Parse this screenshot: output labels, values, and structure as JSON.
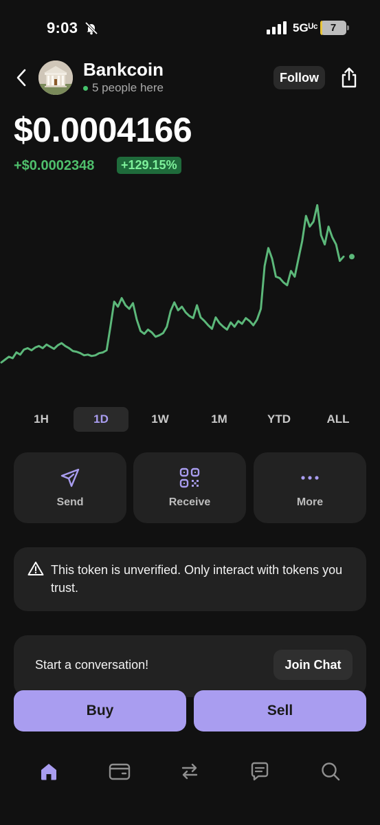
{
  "status_bar": {
    "time": "9:03",
    "network": "5Gᵁᶜ",
    "battery_level": "7",
    "battery_fraction": 0.07,
    "icons": [
      "bell-slash-icon",
      "signal-icon",
      "battery-icon"
    ]
  },
  "header": {
    "token_name": "Bankcoin",
    "presence": "5 people here",
    "follow_label": "Follow",
    "icons": [
      "back-icon",
      "share-icon"
    ]
  },
  "price": {
    "value": "$0.0004166",
    "change_abs": "+$0.0002348",
    "change_pct": "+129.15%"
  },
  "colors": {
    "accent": "#a99df0",
    "positive": "#4fbf6c",
    "chart_line": "#5cb87a",
    "background": "#111111",
    "card": "#222222"
  },
  "chart_data": {
    "type": "line",
    "title": "",
    "xlabel": "",
    "ylabel": "",
    "grid": false,
    "series": [
      {
        "values": [
          20,
          24,
          28,
          26,
          34,
          31,
          38,
          40,
          37,
          41,
          43,
          40,
          45,
          42,
          39,
          44,
          47,
          43,
          40,
          36,
          35,
          33,
          30,
          31,
          29,
          30,
          33,
          34,
          37,
          70,
          105,
          98,
          110,
          100,
          95,
          103,
          80,
          64,
          60,
          66,
          62,
          56,
          58,
          61,
          70,
          92,
          104,
          93,
          98,
          90,
          85,
          82,
          100,
          83,
          78,
          72,
          67,
          83,
          75,
          70,
          66,
          76,
          70,
          78,
          74,
          82,
          78,
          72,
          80,
          95,
          155,
          180,
          165,
          140,
          138,
          132,
          128,
          148,
          140,
          165,
          190,
          225,
          210,
          217,
          240,
          198,
          185,
          210,
          195,
          185,
          162,
          168
        ]
      }
    ]
  },
  "timeframes": {
    "items": [
      "1H",
      "1D",
      "1W",
      "1M",
      "YTD",
      "ALL"
    ],
    "selected": "1D"
  },
  "actions": {
    "send": "Send",
    "receive": "Receive",
    "more": "More"
  },
  "warning": {
    "text": "This token is unverified. Only interact with tokens you trust."
  },
  "conversation": {
    "prompt": "Start a conversation!",
    "join_label": "Join Chat"
  },
  "trade": {
    "buy": "Buy",
    "sell": "Sell"
  },
  "nav": {
    "active": "home",
    "items": [
      "home-icon",
      "wallet-icon",
      "swap-icon",
      "chat-icon",
      "search-icon"
    ]
  }
}
